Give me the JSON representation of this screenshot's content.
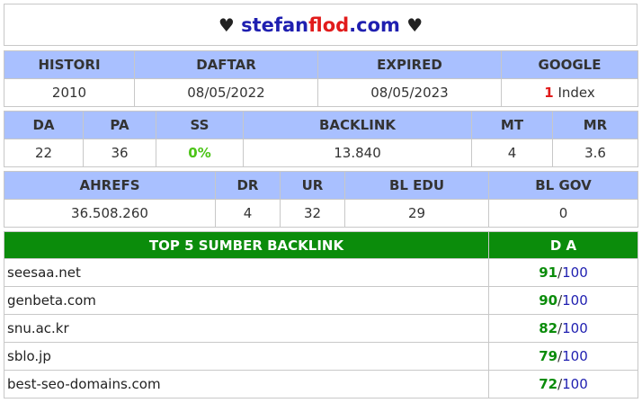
{
  "header": {
    "heart_left": "♥",
    "site_part1": "stefan",
    "site_part2": "flod",
    "site_part3": ".com",
    "heart_right": "♥"
  },
  "row1": {
    "headers": [
      "HISTORI",
      "DAFTAR",
      "EXPIRED",
      "GOOGLE"
    ],
    "histori": "2010",
    "daftar": "08/05/2022",
    "expired": "08/05/2023",
    "google_count": "1",
    "google_label": "Index"
  },
  "row2": {
    "headers": [
      "DA",
      "PA",
      "SS",
      "BACKLINK",
      "MT",
      "MR"
    ],
    "da": "22",
    "pa": "36",
    "ss": "0%",
    "backlink": "13.840",
    "mt": "4",
    "mr": "3.6"
  },
  "row3": {
    "headers": [
      "AHREFS",
      "DR",
      "UR",
      "BL EDU",
      "BL GOV"
    ],
    "ahrefs": "36.508.260",
    "dr": "4",
    "ur": "32",
    "bl_edu": "29",
    "bl_gov": "0"
  },
  "backlinks": {
    "header_source": "TOP 5 SUMBER BACKLINK",
    "header_da": "D A",
    "max_label": "100",
    "slash": "/",
    "rows": [
      {
        "domain": "seesaa.net",
        "da": "91"
      },
      {
        "domain": "genbeta.com",
        "da": "90"
      },
      {
        "domain": "snu.ac.kr",
        "da": "82"
      },
      {
        "domain": "sblo.jp",
        "da": "79"
      },
      {
        "domain": "best-seo-domains.com",
        "da": "72"
      }
    ]
  },
  "colors": {
    "header_blue": "#a9c0ff",
    "header_green": "#0b8c0b",
    "accent_red": "#e11b1b",
    "accent_blue": "#1f1fb0",
    "ss_green": "#4cc417"
  }
}
